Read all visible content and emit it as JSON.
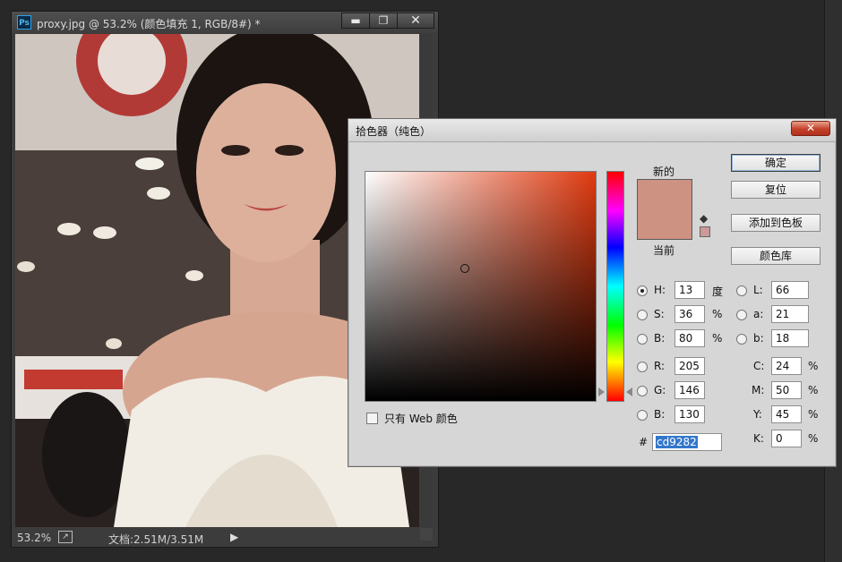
{
  "document": {
    "app_icon": "Ps",
    "title": "proxy.jpg @ 53.2% (颜色填充 1, RGB/8#) *",
    "buttons": {
      "minimize": "▬",
      "maximize": "❐",
      "close": "✕"
    },
    "status": {
      "zoom": "53.2%",
      "doc_size": "文档:2.51M/3.51M",
      "menu_arrow": "▶"
    }
  },
  "picker": {
    "title": "拾色器（纯色）",
    "close": "✕",
    "new_label": "新的",
    "current_label": "当前",
    "new_color": "#cd9282",
    "current_color": "#cd9282",
    "websafe_color": "#cc9999",
    "buttons": {
      "ok": "确定",
      "reset": "复位",
      "add_to_swatches": "添加到色板",
      "color_libraries": "颜色库"
    },
    "hsb": {
      "h": {
        "label": "H:",
        "value": "13",
        "unit": "度"
      },
      "s": {
        "label": "S:",
        "value": "36",
        "unit": "%"
      },
      "b": {
        "label": "B:",
        "value": "80",
        "unit": "%"
      }
    },
    "rgb": {
      "r": {
        "label": "R:",
        "value": "205"
      },
      "g": {
        "label": "G:",
        "value": "146"
      },
      "b": {
        "label": "B:",
        "value": "130"
      }
    },
    "lab": {
      "l": {
        "label": "L:",
        "value": "66"
      },
      "a": {
        "label": "a:",
        "value": "21"
      },
      "b": {
        "label": "b:",
        "value": "18"
      }
    },
    "cmyk": {
      "c": {
        "label": "C:",
        "value": "24",
        "unit": "%"
      },
      "m": {
        "label": "M:",
        "value": "50",
        "unit": "%"
      },
      "y": {
        "label": "Y:",
        "value": "45",
        "unit": "%"
      },
      "k": {
        "label": "K:",
        "value": "0",
        "unit": "%"
      }
    },
    "hex_prefix": "#",
    "hex_value": "cd9282",
    "only_web_colors": {
      "label": "只有 Web 颜色",
      "checked": false
    },
    "selected_channel": "H"
  }
}
